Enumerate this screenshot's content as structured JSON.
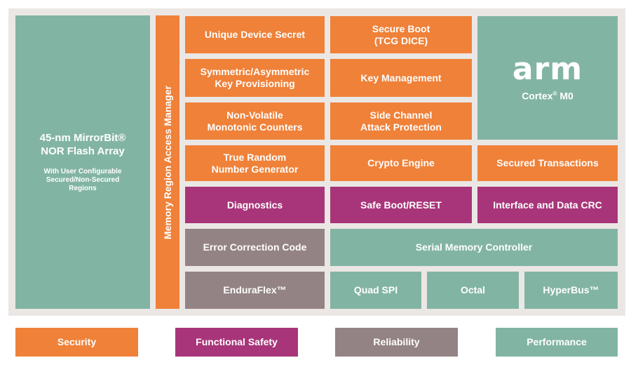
{
  "flash": {
    "title1": "45-nm MirrorBit®",
    "title2": "NOR Flash Array",
    "sub1": "With User Configurable",
    "sub2": "Secured/Non-Secured",
    "sub3": "Regions"
  },
  "mram": "Memory Region Access Manager",
  "blocks": {
    "uds": [
      "Unique Device Secret"
    ],
    "secure_boot": [
      "Secure Boot",
      "(TCG DICE)"
    ],
    "sym": [
      "Symmetric/Asymmetric",
      "Key Provisioning"
    ],
    "keymgmt": [
      "Key Management"
    ],
    "nvmc": [
      "Non-Volatile",
      "Monotonic Counters"
    ],
    "sca": [
      "Side Channel",
      "Attack Protection"
    ],
    "trng": [
      "True Random",
      "Number Generator"
    ],
    "crypto": [
      "Crypto Engine"
    ],
    "sectx": [
      "Secured Transactions"
    ],
    "diag": [
      "Diagnostics"
    ],
    "safeboot": [
      "Safe Boot/RESET"
    ],
    "crc": [
      "Interface and Data CRC"
    ],
    "ecc": [
      "Error Correction Code"
    ],
    "smc": [
      "Serial Memory Controller"
    ],
    "endura": [
      "EnduraFlex™"
    ],
    "qspi": [
      "Quad SPI"
    ],
    "octal": [
      "Octal"
    ],
    "hyperbus": [
      "HyperBus™"
    ]
  },
  "cpu": {
    "logo": "arm",
    "name": "Cortex",
    "reg": "®",
    "model": " M0"
  },
  "legend": [
    "Security",
    "Functional Safety",
    "Reliability",
    "Performance"
  ],
  "colors": {
    "security": "#ef8139",
    "functional_safety": "#a83579",
    "reliability": "#948384",
    "performance": "#82b4a4",
    "background": "#ebe7e5"
  }
}
